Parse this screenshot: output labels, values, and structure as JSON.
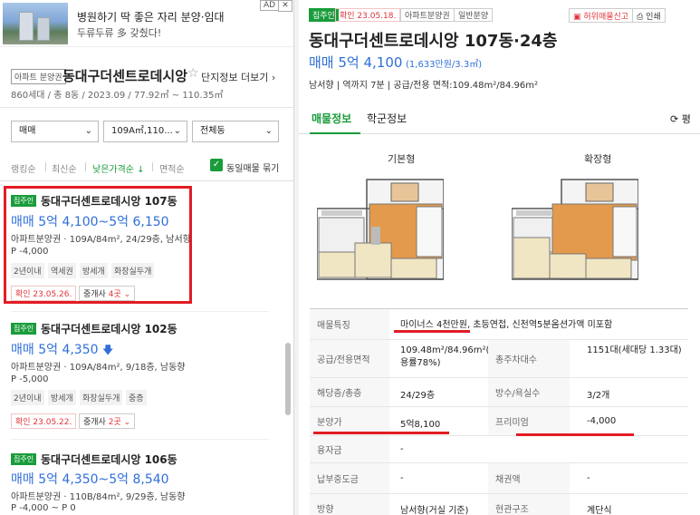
{
  "ad": {
    "title": "병원하기 딱 좋은 자리 분양·임대",
    "subtitle": "두류두류 多 갖췄다!",
    "ad_tag": "AD",
    "close": "✕"
  },
  "complex": {
    "tag": "아파트 분양권",
    "name": "동대구더센트로데시앙",
    "more": "단지정보 더보기 ›",
    "info": "860세대 / 총 8동 / 2023.09 / 77.92㎡ ~ 110.35㎡"
  },
  "filters": {
    "trade": "매매",
    "area": "109A㎡,110...",
    "dong": "전체동",
    "chevron": "⌄"
  },
  "sort": {
    "options": [
      "랭킹순",
      "최신순",
      "낮은가격순 ↓",
      "면적순"
    ],
    "same_listing_label": "동일매물 묶기"
  },
  "listings": [
    {
      "badge": "집주인",
      "title": "동대구더센트로데시앙 107동",
      "price": "매매 5억 4,100~5억 6,150",
      "info": "아파트분양권 · 109A/84m², 24/29층, 남서향",
      "premium": "P -4,000",
      "tags": [
        "2년이내",
        "역세권",
        "방세개",
        "화장실두개"
      ],
      "confirm": "확인 23.05.26.",
      "agent": "중개사",
      "agent_count": "4곳 ⌄"
    },
    {
      "badge": "집주인",
      "title": "동대구더센트로데시앙 102동",
      "price": "매매 5억 4,350",
      "price_arrow": "🡇",
      "info": "아파트분양권 · 109A/84m², 9/18층, 남동향",
      "premium": "P -5,000",
      "tags": [
        "2년이내",
        "방세개",
        "화장실두개",
        "중층"
      ],
      "confirm": "확인 23.05.22.",
      "agent": "중개사",
      "agent_count": "2곳 ⌄"
    },
    {
      "badge": "집주인",
      "title": "동대구더센트로데시앙 106동",
      "price": "매매 5억 4,350~5억 8,540",
      "info": "아파트분양권 · 110B/84m², 9/29층, 남동향",
      "premium": "P -4,000 ~ P 0"
    }
  ],
  "detail": {
    "badge_owner": "집주인",
    "badge_confirm": "확인 23.05.18.",
    "badge_type": "아파트분양권",
    "badge_sale": "일반분양",
    "report_btn": "허위매물신고",
    "print_btn": "인쇄",
    "title": "동대구더센트로데시앙 107동·24층",
    "price": "매매 5억 4,100",
    "price_per": "(1,633만원/3.3㎡)",
    "desc": "남서향  |  역까지 7분  |  공급/전용 면적:109.48m²/84.96m²",
    "tabs": [
      "매물정보",
      "학군정보"
    ],
    "tab_right": "평",
    "plans": [
      "기본형",
      "확장형"
    ],
    "rows": [
      {
        "k1": "매물특징",
        "v1": "마이너스 4천만원, 초등연접, 신천역5분옴션가액 미포함"
      },
      {
        "k1": "공급/전용면적",
        "v1": "109.48m²/84.96m²(전용률78%)",
        "k2": "총주차대수",
        "v2": "1151대(세대당 1.33대)"
      },
      {
        "k1": "해당층/총층",
        "v1": "24/29층",
        "k2": "방수/욕실수",
        "v2": "3/2개"
      },
      {
        "k1": "분양가",
        "v1": "5억8,100",
        "k2": "프리미엄",
        "v2": "-4,000"
      },
      {
        "k1": "융자금",
        "v1": "-"
      },
      {
        "k1": "납부중도금",
        "v1": "-",
        "k2": "채권액",
        "v2": "-"
      },
      {
        "k1": "방향",
        "v1": "남서향(거실 기준)",
        "k2": "현관구조",
        "v2": "계단식"
      }
    ]
  }
}
